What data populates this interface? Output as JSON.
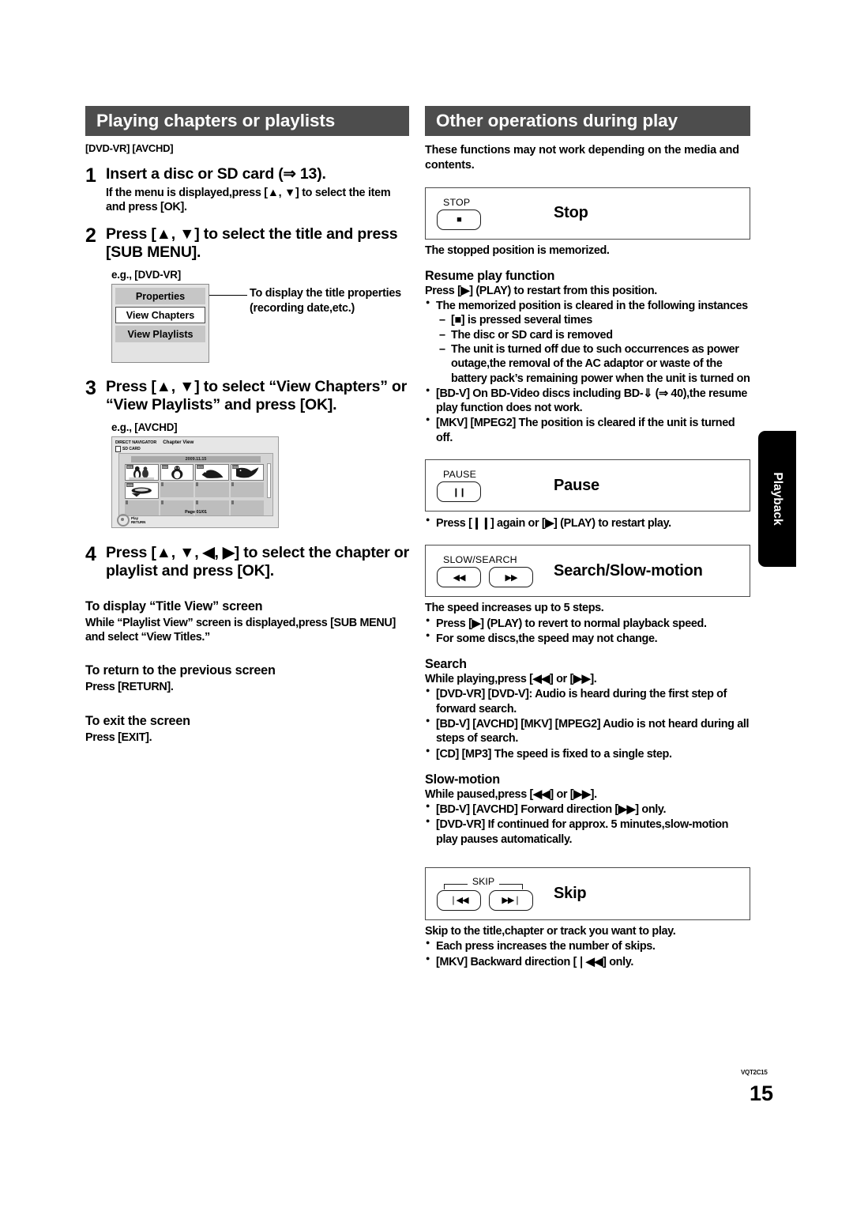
{
  "page": {
    "number": "15",
    "doc_code": "VQT2C15",
    "side_tab": "Playback"
  },
  "left": {
    "section_title": "Playing chapters or playlists",
    "media_tags": "[DVD-VR] [AVCHD]",
    "steps": [
      {
        "num": "1",
        "title": "Insert a disc or SD card (⇒ 13).",
        "sub": "If the menu is displayed,press [▲, ▼] to select the item and press [OK]."
      },
      {
        "num": "2",
        "title": "Press [▲, ▼] to select the title and press [SUB MENU].",
        "sub": ""
      },
      {
        "num": "3",
        "title": "Press [▲, ▼] to select “View Chapters” or “View Playlists” and press [OK].",
        "sub": ""
      },
      {
        "num": "4",
        "title": "Press [▲, ▼, ◀, ▶] to select the chapter or playlist and press [OK].",
        "sub": ""
      }
    ],
    "eg_dvdvr": "e.g., [DVD-VR]",
    "submenu": {
      "items": [
        "Properties",
        "View Chapters",
        "View Playlists"
      ],
      "callout": "To display the title properties (recording date,etc.)"
    },
    "eg_avchd": "e.g., [AVCHD]",
    "direct_navigator": {
      "title": "DIRECT NAVIGATOR",
      "mode": "Chapter View",
      "card": "SD CARD",
      "date": "2009.11.15",
      "page": "Page 01/01",
      "key_play": "Play",
      "key_return": "RETURN"
    },
    "title_view": {
      "head": "To display “Title View” screen",
      "body": "While “Playlist View” screen is displayed,press [SUB MENU] and select “View Titles.”"
    },
    "return_prev": {
      "head": "To return to the previous screen",
      "body": "Press [RETURN]."
    },
    "exit_screen": {
      "head": "To exit the screen",
      "body": "Press [EXIT]."
    }
  },
  "right": {
    "section_title": "Other operations during play",
    "intro": "These functions may not work depending on the media and contents.",
    "stop": {
      "caption": "STOP",
      "glyph": "■",
      "label": "Stop",
      "note": "The stopped position is memorized.",
      "resume_head": "Resume play function",
      "resume_line": "Press [▶] (PLAY) to restart from this position.",
      "bullets": [
        "The memorized position is cleared in the following instances"
      ],
      "dashes": [
        "[■] is pressed several times",
        "The disc or SD card is removed",
        "The unit is turned off due to such occurrences as power outage,the removal of the AC adaptor or waste of the battery pack’s remaining power when the unit is turned on"
      ],
      "bullets2": [
        "[BD-V] On BD-Video discs including BD-⇓ (⇒ 40),the resume play function does not work.",
        "[MKV] [MPEG2] The position is cleared if the unit is turned off."
      ]
    },
    "pause": {
      "caption": "PAUSE",
      "glyph": "❙❙",
      "label": "Pause",
      "bullets": [
        "Press [❙❙] again or [▶] (PLAY) to restart play."
      ]
    },
    "search": {
      "caption": "SLOW/SEARCH",
      "glyph_left": "◀◀",
      "glyph_right": "▶▶",
      "label": "Search/Slow-motion",
      "note": "The speed increases up to 5 steps.",
      "bullets": [
        "Press [▶] (PLAY) to revert to normal playback speed.",
        "For some discs,the speed may not change."
      ],
      "search_head": "Search",
      "search_line": "While playing,press [◀◀] or [▶▶].",
      "search_bullets": [
        "[DVD-VR] [DVD-V]: Audio is heard during the first step of forward search.",
        "[BD-V] [AVCHD] [MKV] [MPEG2] Audio is not heard during all steps of search.",
        "[CD] [MP3] The speed is fixed to a single step."
      ],
      "slow_head": "Slow-motion",
      "slow_line": "While paused,press [◀◀] or [▶▶].",
      "slow_bullets": [
        "[BD-V] [AVCHD] Forward direction [▶▶] only.",
        "[DVD-VR] If continued for approx. 5 minutes,slow-motion play pauses automatically."
      ]
    },
    "skip": {
      "caption": "SKIP",
      "glyph_left": "❘◀◀",
      "glyph_right": "▶▶❘",
      "label": "Skip",
      "note": "Skip to the title,chapter or track you want to play.",
      "bullets": [
        "Each press increases the number of skips.",
        "[MKV] Backward direction [❘◀◀] only."
      ]
    }
  }
}
